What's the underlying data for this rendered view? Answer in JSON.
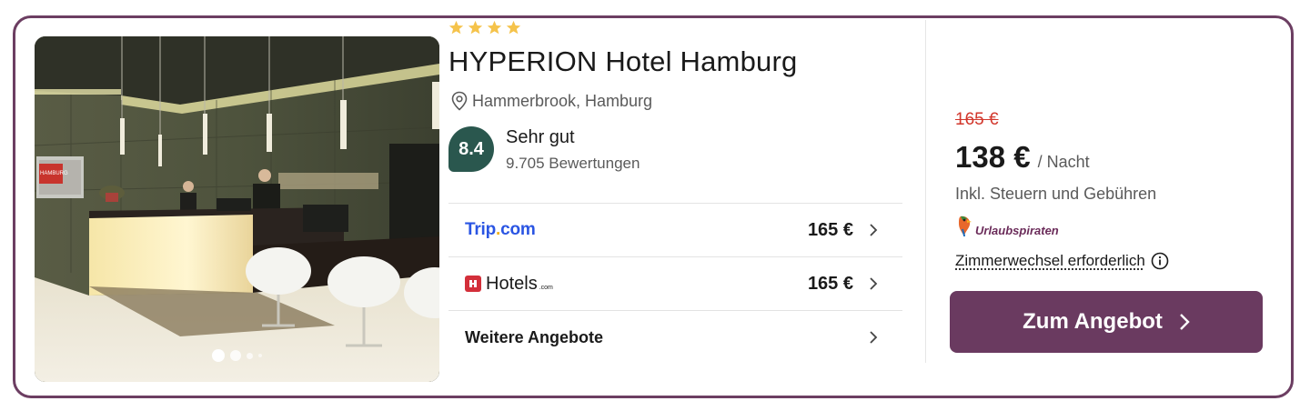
{
  "hotel": {
    "name": "HYPERION Hotel Hamburg",
    "stars": 4,
    "location": "Hammerbrook, Hamburg",
    "photo": {
      "carousel_dots": 4,
      "active_index": 0,
      "screen_text": "HAMBURG"
    }
  },
  "rating": {
    "score": "8.4",
    "label": "Sehr gut",
    "count": "9.705 Bewertungen"
  },
  "offers": [
    {
      "provider": "Trip.com",
      "provider_parts": [
        "Trip",
        ".",
        "com"
      ],
      "price": "165 €"
    },
    {
      "provider": "Hotels.com",
      "provider_parts": [
        "Hotels",
        ".com"
      ],
      "price": "165 €"
    }
  ],
  "more_offers": {
    "label": "Weitere Angebote"
  },
  "price": {
    "old": "165 €",
    "current": "138 €",
    "unit": "/ Nacht",
    "tax_note": "Inkl. Steuern und Gebühren",
    "provider": "Urlaubspiraten",
    "room_note": "Zimmerwechsel erforderlich"
  },
  "cta": {
    "label": "Zum Angebot"
  },
  "colors": {
    "card_border": "#6c3e62",
    "cta_bg": "#6a3a60",
    "rating_bg": "#2a574e",
    "old_price": "#d2372c",
    "star": "#f5c34b",
    "tripcom_blue": "#2a55e3",
    "hotels_red": "#d32f3a"
  },
  "icons": {
    "star": "star-icon",
    "location": "location-pin-icon",
    "chevron": "chevron-right-icon",
    "info": "info-circle-icon",
    "provider": "parrot-logo-icon"
  }
}
